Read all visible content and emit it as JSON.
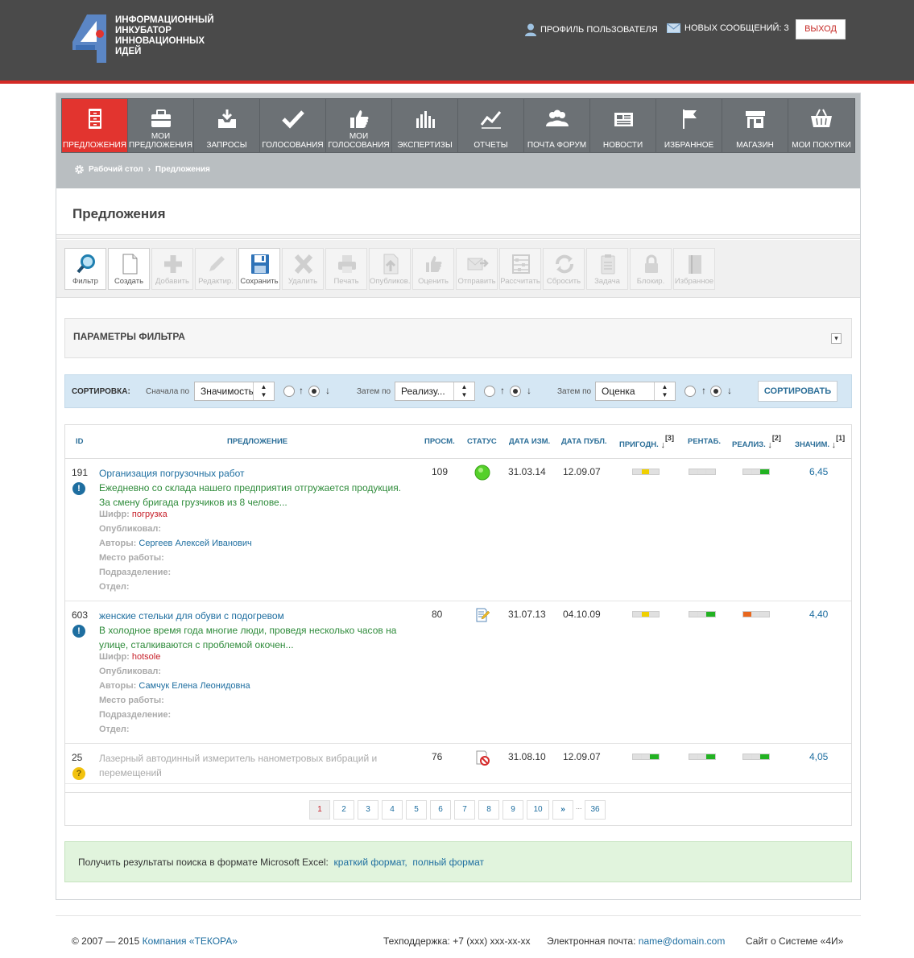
{
  "header": {
    "logo_lines": [
      "Информационный",
      "инкубатор",
      "инновационных",
      "идей"
    ],
    "profile_label": "Профиль пользователя",
    "messages_label": "Новых сообщений: 3",
    "exit_label": "Выход"
  },
  "nav": {
    "items": [
      {
        "label": "Предложения",
        "icon": "cabinet-icon",
        "active": true
      },
      {
        "label": "Мои предложения",
        "icon": "briefcase-icon",
        "active": false
      },
      {
        "label": "Запросы",
        "icon": "inbox-icon",
        "active": false
      },
      {
        "label": "Голосования",
        "icon": "checkmark-icon",
        "active": false
      },
      {
        "label": "Мои голосования",
        "icon": "thumbs-up-icon",
        "active": false
      },
      {
        "label": "Экспертизы",
        "icon": "bar-chart-icon",
        "active": false
      },
      {
        "label": "Отчеты",
        "icon": "trend-line-icon",
        "active": false
      },
      {
        "label": "Почта форум",
        "icon": "people-icon",
        "active": false
      },
      {
        "label": "Новости",
        "icon": "newspaper-icon",
        "active": false
      },
      {
        "label": "Избранное",
        "icon": "flag-icon",
        "active": false
      },
      {
        "label": "Магазин",
        "icon": "shop-icon",
        "active": false
      },
      {
        "label": "Мои покупки",
        "icon": "basket-icon",
        "active": false
      }
    ]
  },
  "breadcrumb": {
    "home": "Рабочий стол",
    "separator": "›",
    "current": "Предложения"
  },
  "page": {
    "title": "Предложения"
  },
  "toolbar": {
    "buttons": [
      {
        "label": "Фильтр",
        "icon": "magnifier-icon",
        "enabled": true
      },
      {
        "label": "Создать",
        "icon": "blank-page-icon",
        "enabled": true
      },
      {
        "label": "Добавить",
        "icon": "plus-icon",
        "enabled": false
      },
      {
        "label": "Редактир.",
        "icon": "pencil-icon",
        "enabled": false
      },
      {
        "label": "Сохранить",
        "icon": "floppy-disk-icon",
        "enabled": true
      },
      {
        "label": "Удалить",
        "icon": "cross-icon",
        "enabled": false
      },
      {
        "label": "Печать",
        "icon": "printer-icon",
        "enabled": false
      },
      {
        "label": "Опубликов.",
        "icon": "upload-icon",
        "enabled": false
      },
      {
        "label": "Оценить",
        "icon": "thumbs-up-icon",
        "enabled": false
      },
      {
        "label": "Отправить",
        "icon": "send-mail-icon",
        "enabled": false
      },
      {
        "label": "Рассчитать",
        "icon": "abacus-icon",
        "enabled": false
      },
      {
        "label": "Сбросить",
        "icon": "refresh-icon",
        "enabled": false
      },
      {
        "label": "Задача",
        "icon": "clipboard-icon",
        "enabled": false
      },
      {
        "label": "Блокир.",
        "icon": "lock-icon",
        "enabled": false
      },
      {
        "label": "Избранное",
        "icon": "book-icon",
        "enabled": false
      }
    ]
  },
  "filter": {
    "title": "ПАРАМЕТРЫ ФИЛЬТРА",
    "toggle": "▾"
  },
  "sort": {
    "label": "СОРТИРОВКА:",
    "first_label": "Сначала по",
    "first_value": "Значимость",
    "then_label_1": "Затем по",
    "second_value": "Реализу...",
    "then_label_2": "Затем по",
    "third_value": "Оценка",
    "up_arrow": "↑",
    "down_arrow": "↓",
    "button": "СОРТИРОВАТЬ"
  },
  "table": {
    "headers": {
      "id": "ID",
      "title": "ПРЕДЛОЖЕНИЕ",
      "views": "ПРОСМ.",
      "status": "СТАТУС",
      "modified": "ДАТА ИЗМ.",
      "published": "ДАТА ПУБЛ.",
      "suitability": "ПРИГОДН.",
      "suitability_sup": "[3]",
      "profitability": "РЕНТАБ.",
      "realization": "РЕАЛИЗ.",
      "realization_sup": "[2]",
      "significance": "ЗНАЧИМ.",
      "significance_sup": "[1]",
      "sort_arrow": "↓"
    },
    "meta_labels": {
      "cipher": "Шифр:",
      "published_by": "Опубликовал:",
      "authors": "Авторы:",
      "workplace": "Место работы:",
      "subdivision": "Подразделение:",
      "department": "Отдел:"
    },
    "rows": [
      {
        "id": "191",
        "badge": "!",
        "badge_type": "info",
        "title": "Организация погрузочных работ",
        "description": "Ежедневно со склада нашего предприятия отгружается продукция. За смену бригада грузчиков из 8 челове...",
        "cipher": "погрузка",
        "authors": "Сергеев Алексей Иванович",
        "views": "109",
        "status": "green-circle-icon",
        "modified": "31.03.14",
        "published": "12.09.07",
        "suitability": [
          "#e0e0e0",
          "#f0d000",
          "#e0e0e0"
        ],
        "profitability": [
          "#e0e0e0",
          "#e0e0e0",
          "#e0e0e0"
        ],
        "realization": [
          "#e0e0e0",
          "#e0e0e0",
          "#22b222"
        ],
        "significance": "6,45"
      },
      {
        "id": "603",
        "badge": "!",
        "badge_type": "info",
        "title": "женские стельки для обуви с подогревом",
        "description": "В холодное время года многие люди, проведя несколько часов на улице, сталкиваются с проблемой окочен...",
        "cipher": "hotsole",
        "authors": "Самчук Елена Леонидовна",
        "views": "80",
        "status": "edit-document-icon",
        "modified": "31.07.13",
        "published": "04.10.09",
        "suitability": [
          "#e0e0e0",
          "#f0d000",
          "#e0e0e0"
        ],
        "profitability": [
          "#e0e0e0",
          "#e0e0e0",
          "#22b222"
        ],
        "realization": [
          "#e8671e",
          "#e0e0e0",
          "#e0e0e0"
        ],
        "significance": "4,40"
      },
      {
        "id": "25",
        "badge": "?",
        "badge_type": "warn",
        "title": "Лазерный автодинный измеритель нанометровых вибраций и перемещений",
        "views": "76",
        "status": "blocked-document-icon",
        "modified": "31.08.10",
        "published": "12.09.07",
        "suitability": [
          "#e0e0e0",
          "#e0e0e0",
          "#22b222"
        ],
        "profitability": [
          "#e0e0e0",
          "#e0e0e0",
          "#22b222"
        ],
        "realization": [
          "#e0e0e0",
          "#e0e0e0",
          "#22b222"
        ],
        "significance": "4,05"
      }
    ]
  },
  "pagination": {
    "pages": [
      "1",
      "2",
      "3",
      "4",
      "5",
      "6",
      "7",
      "8",
      "9",
      "10"
    ],
    "current": "1",
    "next": "»",
    "dots": "...",
    "last": "36"
  },
  "excel": {
    "text": "Получить результаты поиска в формате Microsoft Excel:",
    "short_link": "краткий формат,",
    "full_link": "полный формат"
  },
  "footer": {
    "copyright": "© 2007 — 2015",
    "company_link": "Компания «ТЕКОРА»",
    "support": "Техподдержка: +7 (xxx) xxx-xx-xx",
    "email_label": "Электронная почта:",
    "email": "name@domain.com",
    "site_link": "Сайт о Системе «4И»"
  },
  "colors": {
    "accent_red": "#e2342f",
    "link_blue": "#1e6ea0",
    "description_green": "#2e8b3a",
    "header_bg": "#4a4a4a"
  }
}
